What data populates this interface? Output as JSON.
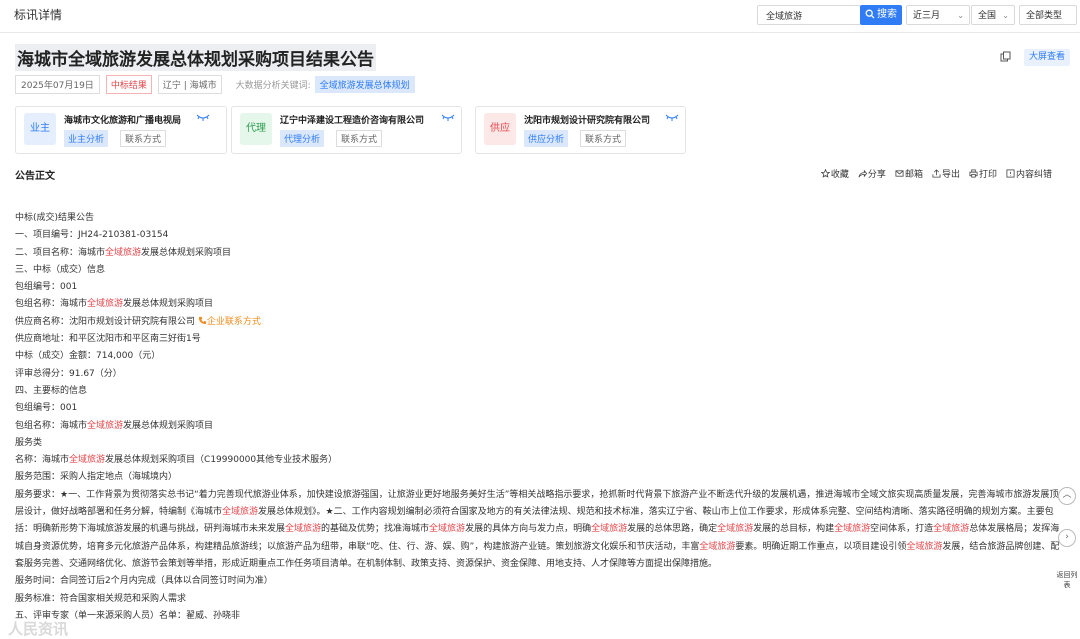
{
  "header": {
    "tab_title": "标讯详情",
    "search_value": "全域旅游",
    "search_button": "搜索",
    "filter_time": "近三月",
    "filter_region": "全国",
    "filter_type": "全部类型"
  },
  "notice": {
    "title": "海城市全域旅游发展总体规划采购项目结果公告",
    "big_screen": "大屏查看",
    "date": "2025年07月19日",
    "status": "中标结果",
    "region": "辽宁 | 海城市",
    "keyword_label": "大数据分析关键词:",
    "keyword": "全域旅游发展总体规划"
  },
  "parties": [
    {
      "role": "业主",
      "name": "海城市文化旅游和广播电视局",
      "analysis": "业主分析",
      "contact": "联系方式",
      "role_bg": "#e4eefc",
      "role_fg": "#2f7cf6"
    },
    {
      "role": "代理",
      "name": "辽宁中泽建设工程造价咨询有限公司",
      "analysis": "代理分析",
      "contact": "联系方式",
      "role_bg": "#e5f6ea",
      "role_fg": "#2e9e53"
    },
    {
      "role": "供应",
      "name": "沈阳市规划设计研究院有限公司",
      "analysis": "供应分析",
      "contact": "联系方式",
      "role_bg": "#fde8e8",
      "role_fg": "#e5484d"
    }
  ],
  "section": {
    "title": "公告正文",
    "actions": [
      "收藏",
      "分享",
      "邮箱",
      "导出",
      "打印",
      "内容纠错"
    ]
  },
  "body": {
    "l1": "中标(成交)结果公告",
    "l2": "一、项目编号：JH24-210381-03154",
    "l3a": "二、项目名称：海城市",
    "kw": "全域旅游",
    "l3b": "发展总体规划采购项目",
    "l4": "三、中标（成交）信息",
    "l5": "包组编号：001",
    "l6a": "包组名称：海城市",
    "l6b": "发展总体规划采购项目",
    "l7a": "供应商名称：沈阳市规划设计研究院有限公司",
    "l7b": "企业联系方式",
    "l8": "供应商地址：和平区沈阳市和平区南三好街1号",
    "l9": "中标（成交）金额：714,000（元）",
    "l10": "评审总得分：91.67（分）",
    "l11": "四、主要标的信息",
    "l12": "包组编号：001",
    "l13a": "包组名称：海城市",
    "l13b": "发展总体规划采购项目",
    "l14": "服务类",
    "l15a": "名称：海城市",
    "l15b": "发展总体规划采购项目（C19990000其他专业技术服务）",
    "l16": "服务范围：采购人指定地点（海城境内）",
    "l17a": "服务要求：★一、工作背景为贯彻落实总书记“着力完善现代旅游业体系，加快建设旅游强国，让旅游业更好地服务美好生活”等相关战略指示要求，抢抓新时代背景下旅游产业不断迭代升级的发展机遇，推进海城市全域文旅实现高质量发展，完善海城市旅游发展顶层设计，做好战略部署和任务分解，特编制《海城市",
    "l17b": "发展总体规划》。★二、工作内容规划编制必须符合国家及地方的有关法律法规、规范和技术标准，落实辽宁省、鞍山市上位工作要求，形成体系完整、空间结构清晰、落实路径明确的规划方案。主要包括：明确新形势下海城旅游发展的机遇与挑战，研判海城市未来发展",
    "l17c": "的基础及优势；找准海城市",
    "l17d": "发展的具体方向与发力点，明确",
    "l17e": "发展的总体思路，确定",
    "l17f": "发展的总目标，构建",
    "l17g": "空间体系，打造",
    "l17h": "总体发展格局；发挥海城自身资源优势，培育多元化旅游产品体系，构建精品旅游线；以旅游产品为纽带，串联“吃、住、行、游、娱、购”，构建旅游产业链。策划旅游文化娱乐和节庆活动，丰富",
    "l17i": "要素。明确近期工作重点，以项目建设引领",
    "l17j": "发展，结合旅游品牌创建、配套服务完善、交通网络优化、旅游节会策划等举措，形成近期重点工作任务项目清单。在机制体制、政策支持、资源保护、资金保障、用地支持、人才保障等方面提出保障措施。",
    "l18": "服务时间：合同签订后2个月内完成（具体以合同签订时间为准）",
    "l19": "服务标准：符合国家相关规范和采购人需求",
    "l20": "五、评审专家（单一来源采购人员）名单：翟威、孙晓非"
  },
  "side": {
    "back_top": "返回列表"
  },
  "watermark": "人民资讯"
}
